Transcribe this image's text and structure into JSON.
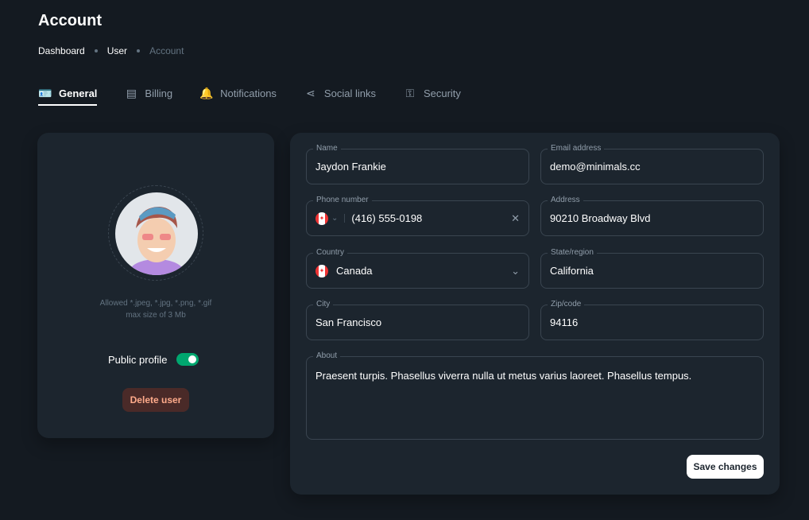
{
  "title": "Account",
  "breadcrumbs": [
    "Dashboard",
    "User",
    "Account"
  ],
  "tabs": [
    {
      "label": "General",
      "icon": "id-card-icon"
    },
    {
      "label": "Billing",
      "icon": "receipt-icon"
    },
    {
      "label": "Notifications",
      "icon": "bell-icon"
    },
    {
      "label": "Social links",
      "icon": "share-icon"
    },
    {
      "label": "Security",
      "icon": "key-icon"
    }
  ],
  "profile": {
    "hint1": "Allowed *.jpeg, *.jpg, *.png, *.gif",
    "hint2": "max size of 3 Mb",
    "public_label": "Public profile",
    "public_on": true,
    "delete_label": "Delete user"
  },
  "form": {
    "name": {
      "label": "Name",
      "value": "Jaydon Frankie"
    },
    "email": {
      "label": "Email address",
      "value": "demo@minimals.cc"
    },
    "phone": {
      "label": "Phone number",
      "value": "(416) 555-0198"
    },
    "address": {
      "label": "Address",
      "value": "90210 Broadway Blvd"
    },
    "country": {
      "label": "Country",
      "value": "Canada"
    },
    "state": {
      "label": "State/region",
      "value": "California"
    },
    "city": {
      "label": "City",
      "value": "San Francisco"
    },
    "zip": {
      "label": "Zip/code",
      "value": "94116"
    },
    "about": {
      "label": "About",
      "value": "Praesent turpis. Phasellus viverra nulla ut metus varius laoreet. Phasellus tempus."
    },
    "save_label": "Save changes"
  },
  "colors": {
    "accent": "#00a76f",
    "danger": "#ffab8b"
  }
}
